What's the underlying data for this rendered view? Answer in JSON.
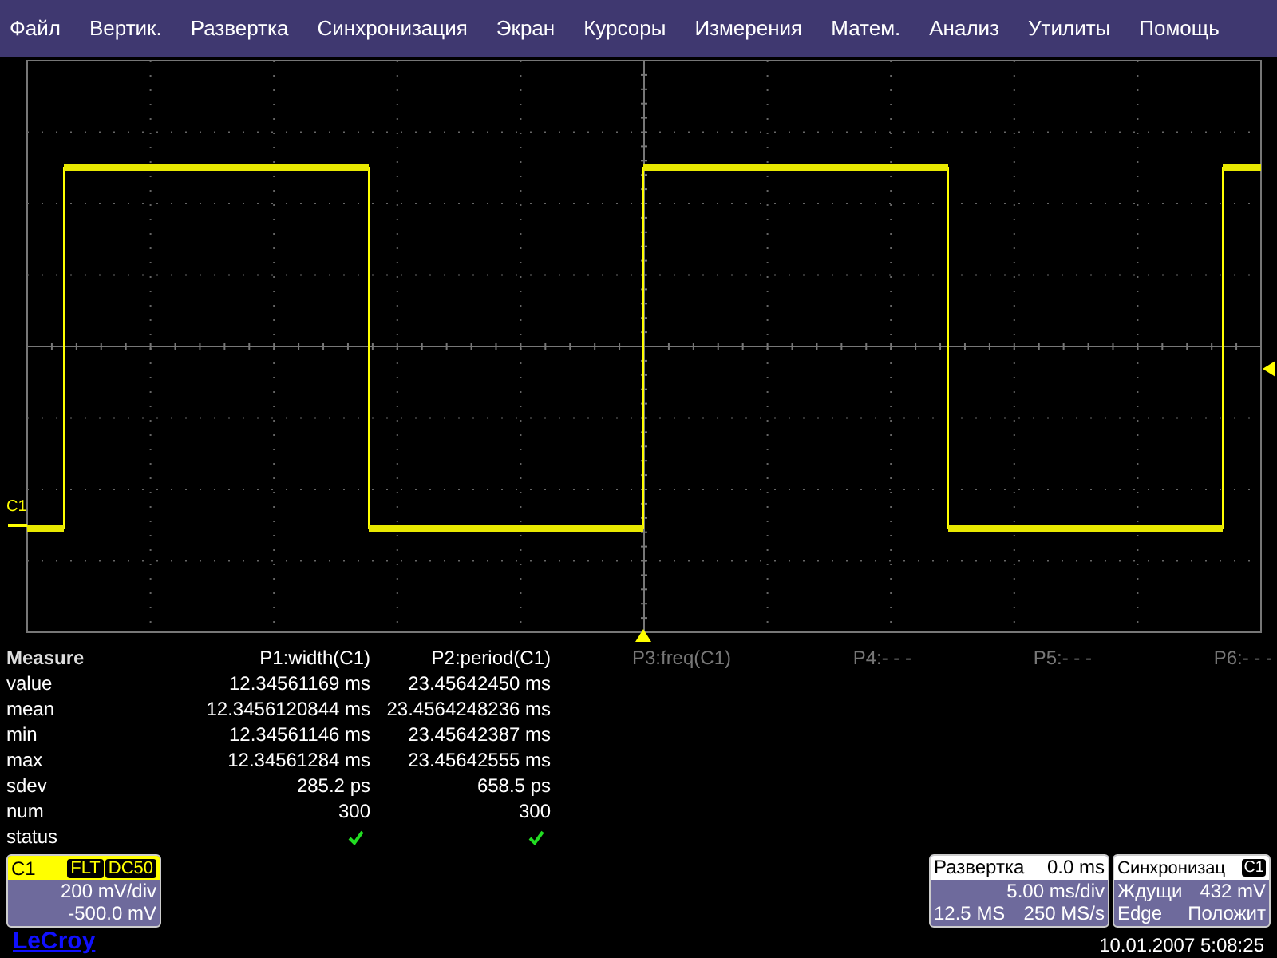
{
  "menu": [
    "Файл",
    "Вертик.",
    "Развертка",
    "Синхронизация",
    "Экран",
    "Курсоры",
    "Измерения",
    "Матем.",
    "Анализ",
    "Утилиты",
    "Помощь"
  ],
  "channel_marker": "C1",
  "measure": {
    "title": "Measure",
    "params": [
      {
        "label": "P1:width(C1)",
        "enabled": true
      },
      {
        "label": "P2:period(C1)",
        "enabled": true
      },
      {
        "label": "P3:freq(C1)",
        "enabled": false
      },
      {
        "label": "P4:- - -",
        "enabled": false
      },
      {
        "label": "P5:- - -",
        "enabled": false
      },
      {
        "label": "P6:- - -",
        "enabled": false
      }
    ],
    "rows": [
      {
        "kind": "text",
        "label": "value",
        "values": [
          "12.34561169 ms",
          "23.45642450 ms"
        ]
      },
      {
        "kind": "text",
        "label": "mean",
        "values": [
          "12.3456120844 ms",
          "23.4564248236 ms"
        ]
      },
      {
        "kind": "text",
        "label": "min",
        "values": [
          "12.34561146 ms",
          "23.45642387 ms"
        ]
      },
      {
        "kind": "text",
        "label": "max",
        "values": [
          "12.34561284 ms",
          "23.45642555 ms"
        ]
      },
      {
        "kind": "text",
        "label": "sdev",
        "values": [
          "285.2 ps",
          "658.5 ps"
        ]
      },
      {
        "kind": "text",
        "label": "num",
        "values": [
          "300",
          "300"
        ]
      },
      {
        "kind": "status",
        "label": "status",
        "passed": [
          true,
          true
        ]
      }
    ]
  },
  "channel_box": {
    "name": "C1",
    "tags": [
      "FLT",
      "DC50"
    ],
    "scale": "200 mV/div",
    "offset": "-500.0 mV"
  },
  "timebase": {
    "title": "Развертка",
    "delay": "0.0 ms",
    "scale": "5.00 ms/div",
    "samples": "12.5 MS",
    "rate": "250 MS/s"
  },
  "trigger": {
    "title": "Синхронизац",
    "source": "C1",
    "mode": "Ждущи",
    "level": "432 mV",
    "type": "Edge",
    "slope": "Положит"
  },
  "logo": "LeCroy",
  "datetime": "10.01.2007 5:08:25"
}
